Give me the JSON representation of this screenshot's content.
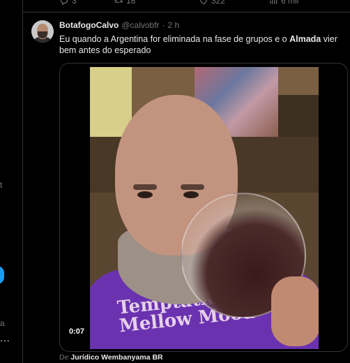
{
  "previous_tweet_actions": [
    {
      "icon": "reply-icon",
      "count": "3"
    },
    {
      "icon": "retweet-icon",
      "count": "18"
    },
    {
      "icon": "like-icon",
      "count": "322"
    },
    {
      "icon": "views-icon",
      "count": "6 mil"
    }
  ],
  "tweet": {
    "display_name": "BotafogoCalvo",
    "handle": "@calvobfr",
    "separator": "·",
    "time": "2 h",
    "text_parts": [
      "Eu quando a Argentina for eliminada na fase de grupos e o ",
      "Almada",
      " vier bem antes do esperado"
    ],
    "media": {
      "duration": "0:07",
      "shirt_text": "Temptations in a Mellow Mood"
    },
    "source_prefix": "De",
    "source_name": "Jurídico Wembanyama BR"
  },
  "left_nav": {
    "more_label": "...",
    "accent_color": "#1d9bf0"
  },
  "colors": {
    "background": "#000000",
    "text_primary": "#e7e9ea",
    "text_secondary": "#71767b",
    "border": "#2f3336"
  }
}
